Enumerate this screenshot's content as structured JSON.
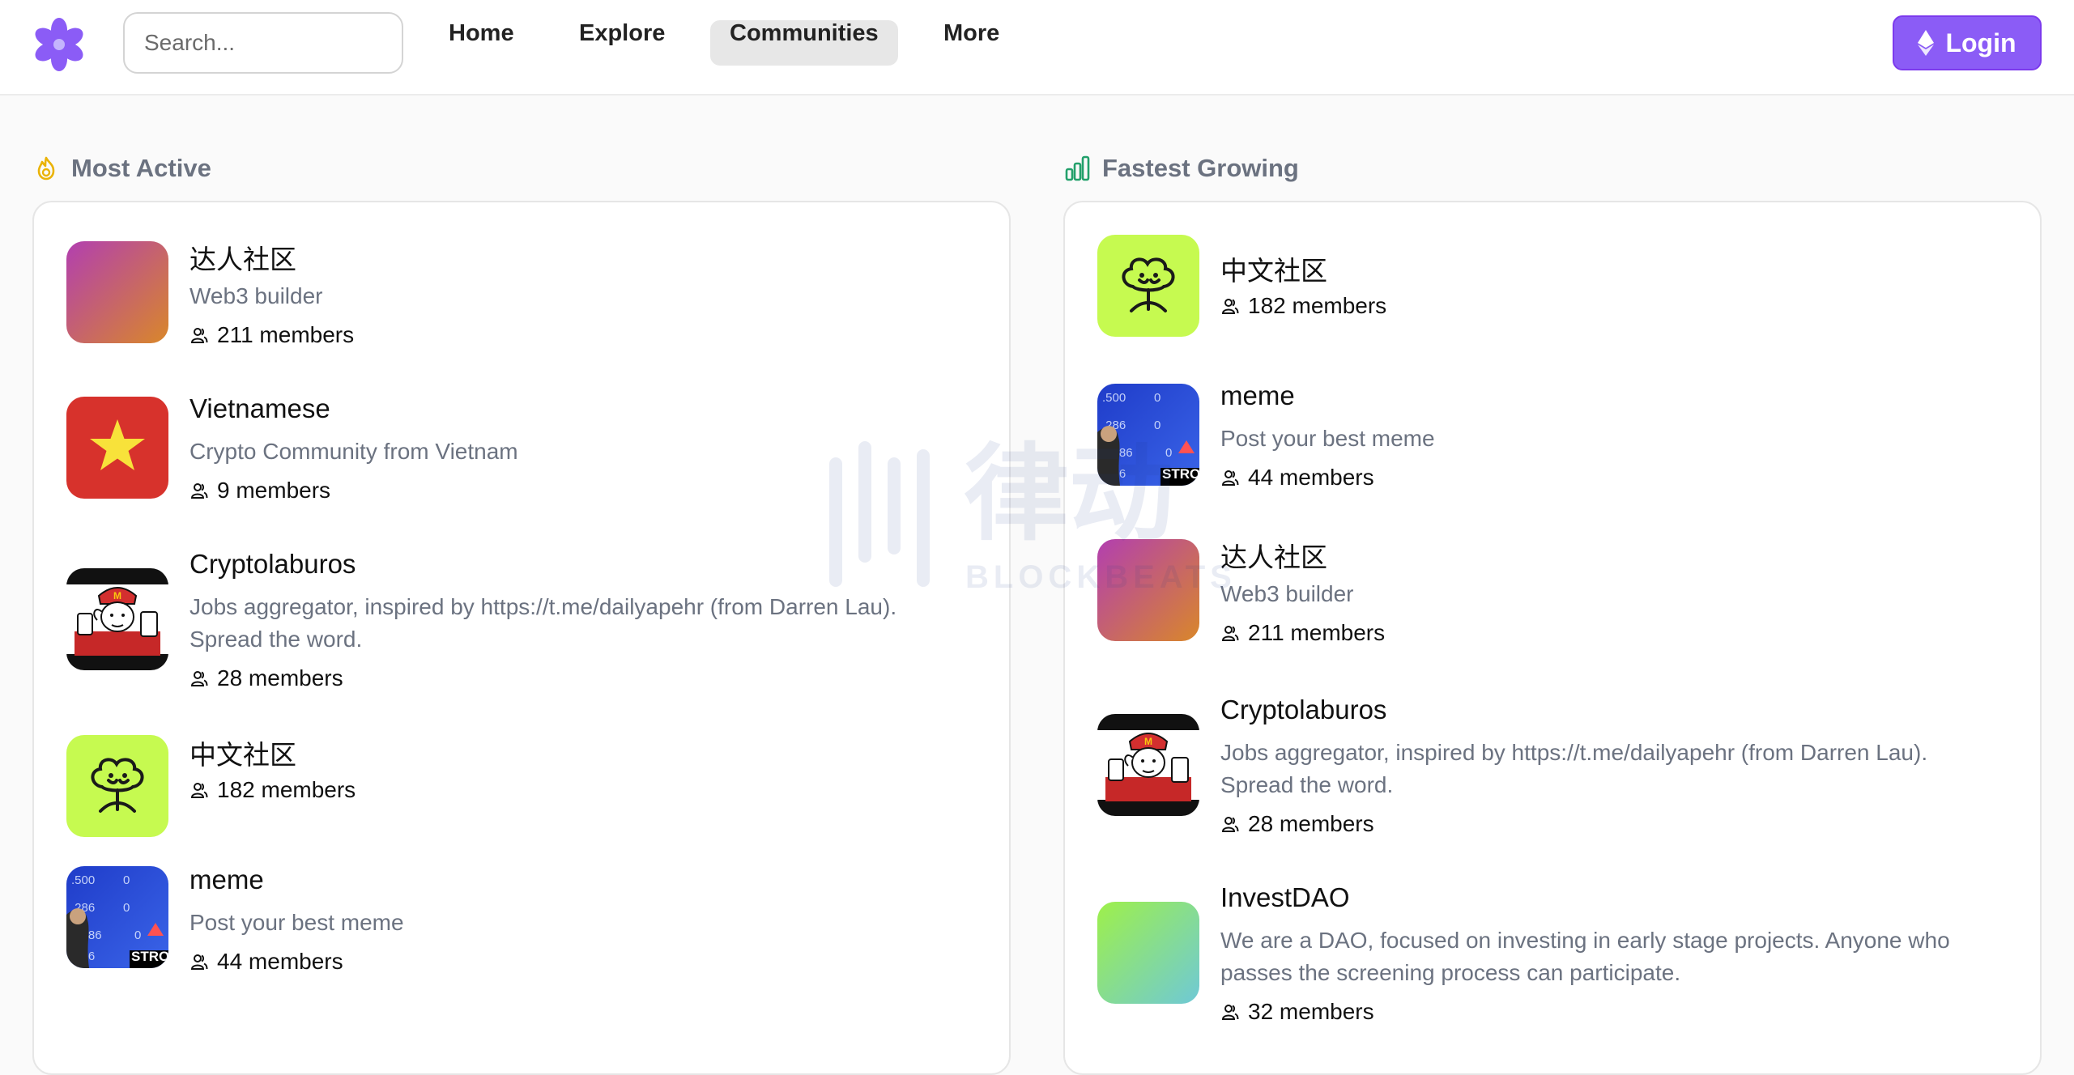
{
  "header": {
    "search_placeholder": "Search...",
    "nav": [
      "Home",
      "Explore",
      "Communities",
      "More"
    ],
    "active_nav": "Communities",
    "login_label": "Login"
  },
  "sections": {
    "most_active": {
      "title": "Most Active",
      "items": [
        {
          "name": "达人社区",
          "desc": "Web3 builder",
          "members": "211 members",
          "avatar": "gradient-pink-orange"
        },
        {
          "name": "Vietnamese",
          "desc": "Crypto Community from Vietnam",
          "members": "9 members",
          "avatar": "vietnam-flag"
        },
        {
          "name": "Cryptolaburos",
          "desc": "Jobs aggregator, inspired by https://t.me/dailyapehr (from Darren Lau). Spread the word.",
          "members": "28 members",
          "avatar": "cartoon-man-red-cap"
        },
        {
          "name": "中文社区",
          "desc": "",
          "members": "182 members",
          "avatar": "green-flower-face"
        },
        {
          "name": "meme",
          "desc": "Post your best meme",
          "members": "44 members",
          "avatar": "stock-board-man"
        }
      ]
    },
    "fastest_growing": {
      "title": "Fastest Growing",
      "items": [
        {
          "name": "中文社区",
          "desc": "",
          "members": "182 members",
          "avatar": "green-flower-face"
        },
        {
          "name": "meme",
          "desc": "Post your best meme",
          "members": "44 members",
          "avatar": "stock-board-man"
        },
        {
          "name": "达人社区",
          "desc": "Web3 builder",
          "members": "211 members",
          "avatar": "gradient-pink-orange"
        },
        {
          "name": "Cryptolaburos",
          "desc": "Jobs aggregator, inspired by https://t.me/dailyapehr (from Darren Lau). Spread the word.",
          "members": "28 members",
          "avatar": "cartoon-man-red-cap"
        },
        {
          "name": "InvestDAO",
          "desc": "We are a DAO, focused on investing in early stage projects. Anyone who passes the screening process can participate.",
          "members": "32 members",
          "avatar": "gradient-green-teal"
        }
      ]
    }
  },
  "watermark": {
    "text_cn": "律动",
    "text_en": "BLOCKBEATS"
  },
  "avatar_badge": "STRO",
  "colors": {
    "accent": "#8b5cf6",
    "logo": "#8b5cf6",
    "flame": "#eab308",
    "chart": "#22a06b"
  }
}
